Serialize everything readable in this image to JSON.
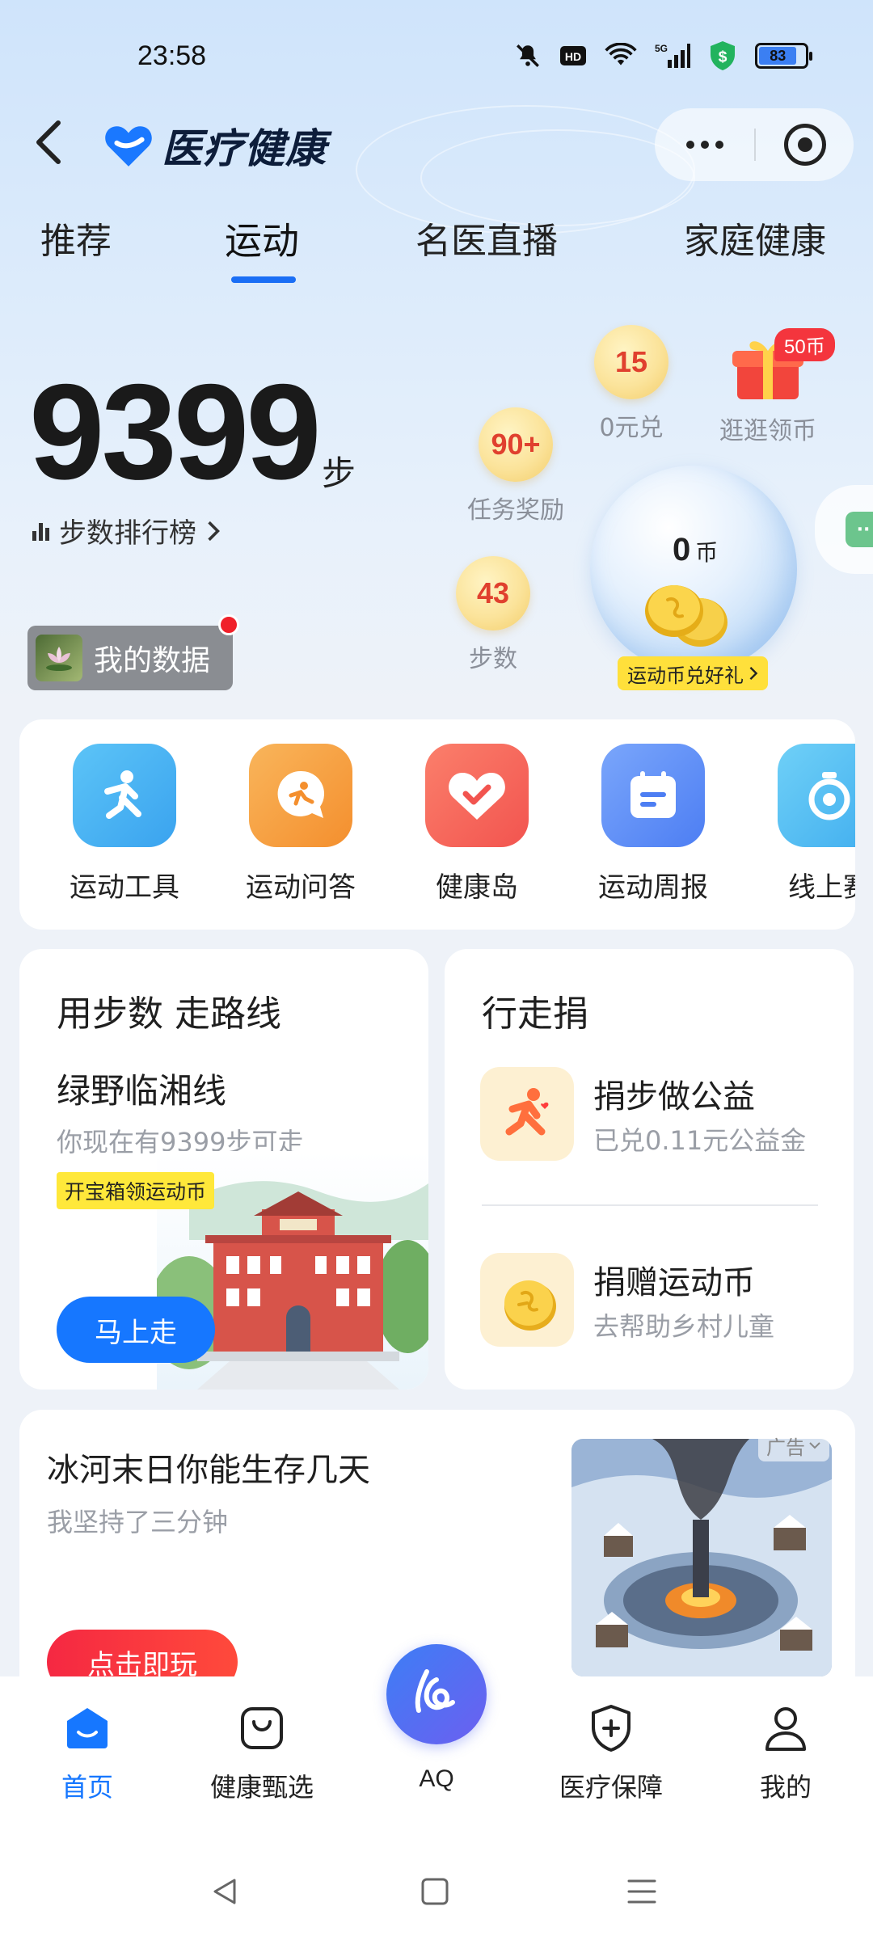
{
  "status_bar": {
    "time": "23:58",
    "icons": [
      "mute-icon",
      "hd-icon",
      "wifi-icon",
      "5g-signal-icon",
      "shield-dollar-icon",
      "battery-icon"
    ],
    "battery_level": "83"
  },
  "header": {
    "app_title": "医疗健康",
    "more_icon": "more-dots-icon",
    "close_icon": "target-close-icon"
  },
  "tabs": [
    {
      "label": "推荐"
    },
    {
      "label": "运动"
    },
    {
      "label": "名医直播"
    },
    {
      "label": "家庭健康"
    }
  ],
  "active_tab": "运动",
  "steps": {
    "count": "9399",
    "unit": "步",
    "rank_label": "步数排行榜"
  },
  "my_data": {
    "label": "我的数据"
  },
  "rewards": {
    "free_exchange": {
      "value": "15",
      "label": "0元兑"
    },
    "task_reward": {
      "value": "90+",
      "label": "任务奖励"
    },
    "step_reward": {
      "value": "43",
      "label": "步数"
    },
    "browse": {
      "label": "逛逛领币",
      "badge": "50币"
    }
  },
  "coin_bubble": {
    "amount": "0",
    "unit": "币",
    "exchange_label": "运动币兑好礼"
  },
  "tools": [
    {
      "label": "运动工具",
      "icon": "running-person-icon",
      "color": "#49b5f3"
    },
    {
      "label": "运动问答",
      "icon": "chat-runner-icon",
      "color": "#f7a347"
    },
    {
      "label": "健康岛",
      "icon": "heart-icon",
      "color": "#f5685b"
    },
    {
      "label": "运动周报",
      "icon": "report-icon",
      "color": "#5b8ef5"
    },
    {
      "label": "线上赛",
      "icon": "ring-icon",
      "color": "#49b5f3"
    }
  ],
  "route_card": {
    "title": "用步数 走路线",
    "route_name": "绿野临湘线",
    "route_desc": "你现在有9399步可走",
    "tag": "开宝箱领运动币",
    "go_button": "马上走"
  },
  "donate_card": {
    "title": "行走捐",
    "items": [
      {
        "name": "捐步做公益",
        "desc": "已兑0.11元公益金"
      },
      {
        "name": "捐赠运动币",
        "desc": "去帮助乡村儿童"
      }
    ]
  },
  "ad_card": {
    "title": "冰河末日你能生存几天",
    "subtitle": "我坚持了三分钟",
    "button": "点击即玩",
    "badge": "广告"
  },
  "bottom_nav": [
    {
      "label": "首页",
      "icon": "home-icon"
    },
    {
      "label": "健康甄选",
      "icon": "shopping-bag-icon"
    },
    {
      "label": "AQ",
      "icon": "aq-icon"
    },
    {
      "label": "医疗保障",
      "icon": "shield-plus-icon"
    },
    {
      "label": "我的",
      "icon": "person-icon"
    }
  ],
  "active_nav": "首页",
  "colors": {
    "accent": "#1677ff",
    "tab_underline": "#1a6ef5",
    "go_button": "#1677ff",
    "play_button": "#f52842",
    "tag_yellow": "#ffe83a"
  }
}
